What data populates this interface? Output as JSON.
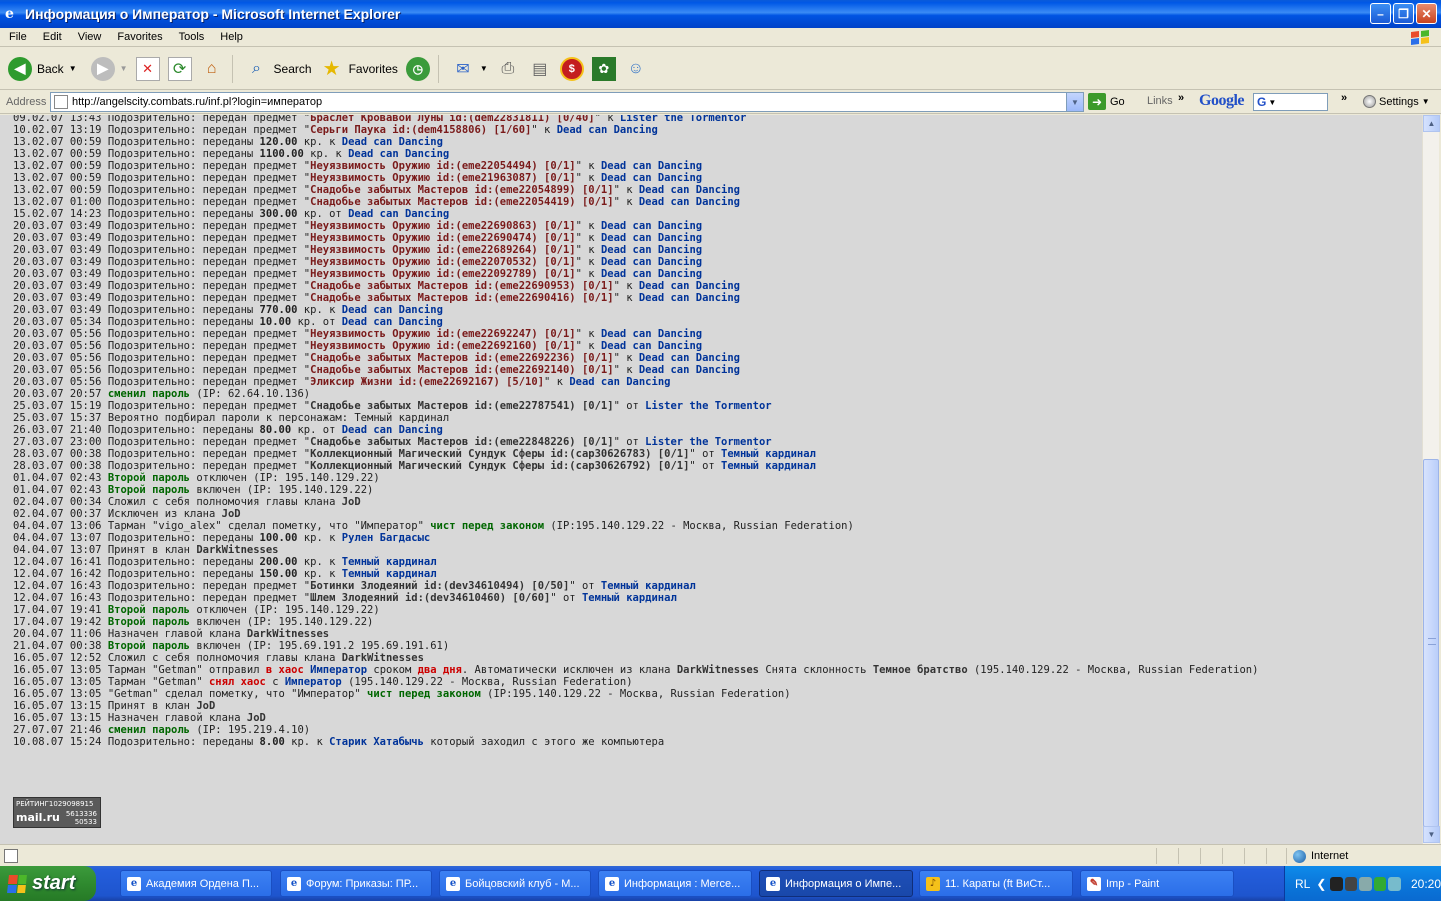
{
  "window": {
    "title": "Информация о Император - Microsoft Internet Explorer"
  },
  "menu": [
    "File",
    "Edit",
    "View",
    "Favorites",
    "Tools",
    "Help"
  ],
  "toolbar": {
    "back": "Back",
    "search": "Search",
    "favorites": "Favorites"
  },
  "address": {
    "label": "Address",
    "url": "http://angelscity.combats.ru/inf.pl?login=император",
    "go": "Go",
    "links": "Links",
    "google": "Google",
    "google_box": "G",
    "settings": "Settings"
  },
  "log": [
    [
      [
        "09.02.07 13:43 Подозрительно: передан предмет \"",
        ""
      ],
      [
        "Браслет Кровавой Луны id:(dem22831811) [0/40]",
        "item"
      ],
      [
        "\" к ",
        ""
      ],
      [
        "Lister the Tormentor",
        "user"
      ]
    ],
    [
      [
        "10.02.07 13:19 Подозрительно: передан предмет \"",
        ""
      ],
      [
        "Серьги Паука id:(dem4158806) [1/60]",
        "item"
      ],
      [
        "\" к ",
        ""
      ],
      [
        "Dead can Dancing",
        "user"
      ]
    ],
    [
      [
        "13.02.07 00:59 Подозрительно: переданы ",
        ""
      ],
      [
        "120.00",
        "b"
      ],
      [
        " кр. к ",
        ""
      ],
      [
        "Dead can Dancing",
        "user"
      ]
    ],
    [
      [
        "13.02.07 00:59 Подозрительно: переданы ",
        ""
      ],
      [
        "1100.00",
        "b"
      ],
      [
        " кр. к ",
        ""
      ],
      [
        "Dead can Dancing",
        "user"
      ]
    ],
    [
      [
        "13.02.07 00:59 Подозрительно: передан предмет \"",
        ""
      ],
      [
        "Неуязвимость Оружию id:(eme22054494) [0/1]",
        "item"
      ],
      [
        "\" к ",
        ""
      ],
      [
        "Dead can Dancing",
        "user"
      ]
    ],
    [
      [
        "13.02.07 00:59 Подозрительно: передан предмет \"",
        ""
      ],
      [
        "Неуязвимость Оружию id:(eme21963087) [0/1]",
        "item"
      ],
      [
        "\" к ",
        ""
      ],
      [
        "Dead can Dancing",
        "user"
      ]
    ],
    [
      [
        "13.02.07 00:59 Подозрительно: передан предмет \"",
        ""
      ],
      [
        "Снадобье забытых Мастеров id:(eme22054899) [0/1]",
        "item"
      ],
      [
        "\" к ",
        ""
      ],
      [
        "Dead can Dancing",
        "user"
      ]
    ],
    [
      [
        "13.02.07 01:00 Подозрительно: передан предмет \"",
        ""
      ],
      [
        "Снадобье забытых Мастеров id:(eme22054419) [0/1]",
        "item"
      ],
      [
        "\" к ",
        ""
      ],
      [
        "Dead can Dancing",
        "user"
      ]
    ],
    [
      [
        "15.02.07 14:23 Подозрительно: переданы ",
        ""
      ],
      [
        "300.00",
        "b"
      ],
      [
        " кр. от ",
        ""
      ],
      [
        "Dead can Dancing",
        "user"
      ]
    ],
    [
      [
        "20.03.07 03:49 Подозрительно: передан предмет \"",
        ""
      ],
      [
        "Неуязвимость Оружию id:(eme22690863) [0/1]",
        "item"
      ],
      [
        "\" к ",
        ""
      ],
      [
        "Dead can Dancing",
        "user"
      ]
    ],
    [
      [
        "20.03.07 03:49 Подозрительно: передан предмет \"",
        ""
      ],
      [
        "Неуязвимость Оружию id:(eme22690474) [0/1]",
        "item"
      ],
      [
        "\" к ",
        ""
      ],
      [
        "Dead can Dancing",
        "user"
      ]
    ],
    [
      [
        "20.03.07 03:49 Подозрительно: передан предмет \"",
        ""
      ],
      [
        "Неуязвимость Оружию id:(eme22689264) [0/1]",
        "item"
      ],
      [
        "\" к ",
        ""
      ],
      [
        "Dead can Dancing",
        "user"
      ]
    ],
    [
      [
        "20.03.07 03:49 Подозрительно: передан предмет \"",
        ""
      ],
      [
        "Неуязвимость Оружию id:(eme22070532) [0/1]",
        "item"
      ],
      [
        "\" к ",
        ""
      ],
      [
        "Dead can Dancing",
        "user"
      ]
    ],
    [
      [
        "20.03.07 03:49 Подозрительно: передан предмет \"",
        ""
      ],
      [
        "Неуязвимость Оружию id:(eme22092789) [0/1]",
        "item"
      ],
      [
        "\" к ",
        ""
      ],
      [
        "Dead can Dancing",
        "user"
      ]
    ],
    [
      [
        "20.03.07 03:49 Подозрительно: передан предмет \"",
        ""
      ],
      [
        "Снадобье забытых Мастеров id:(eme22690953) [0/1]",
        "item"
      ],
      [
        "\" к ",
        ""
      ],
      [
        "Dead can Dancing",
        "user"
      ]
    ],
    [
      [
        "20.03.07 03:49 Подозрительно: передан предмет \"",
        ""
      ],
      [
        "Снадобье забытых Мастеров id:(eme22690416) [0/1]",
        "item"
      ],
      [
        "\" к ",
        ""
      ],
      [
        "Dead can Dancing",
        "user"
      ]
    ],
    [
      [
        "20.03.07 03:49 Подозрительно: переданы ",
        ""
      ],
      [
        "770.00",
        "b"
      ],
      [
        " кр. к ",
        ""
      ],
      [
        "Dead can Dancing",
        "user"
      ]
    ],
    [
      [
        "20.03.07 05:34 Подозрительно: переданы ",
        ""
      ],
      [
        "10.00",
        "b"
      ],
      [
        " кр. от ",
        ""
      ],
      [
        "Dead can Dancing",
        "user"
      ]
    ],
    [
      [
        "20.03.07 05:56 Подозрительно: передан предмет \"",
        ""
      ],
      [
        "Неуязвимость Оружию id:(eme22692247) [0/1]",
        "item"
      ],
      [
        "\" к ",
        ""
      ],
      [
        "Dead can Dancing",
        "user"
      ]
    ],
    [
      [
        "20.03.07 05:56 Подозрительно: передан предмет \"",
        ""
      ],
      [
        "Неуязвимость Оружию id:(eme22692160) [0/1]",
        "item"
      ],
      [
        "\" к ",
        ""
      ],
      [
        "Dead can Dancing",
        "user"
      ]
    ],
    [
      [
        "20.03.07 05:56 Подозрительно: передан предмет \"",
        ""
      ],
      [
        "Снадобье забытых Мастеров id:(eme22692236) [0/1]",
        "item"
      ],
      [
        "\" к ",
        ""
      ],
      [
        "Dead can Dancing",
        "user"
      ]
    ],
    [
      [
        "20.03.07 05:56 Подозрительно: передан предмет \"",
        ""
      ],
      [
        "Снадобье забытых Мастеров id:(eme22692140) [0/1]",
        "item"
      ],
      [
        "\" к ",
        ""
      ],
      [
        "Dead can Dancing",
        "user"
      ]
    ],
    [
      [
        "20.03.07 05:56 Подозрительно: передан предмет \"",
        ""
      ],
      [
        "Эликсир Жизни id:(eme22692167) [5/10]",
        "item"
      ],
      [
        "\" к ",
        ""
      ],
      [
        "Dead can Dancing",
        "user"
      ]
    ],
    [
      [
        "20.03.07 20:57 ",
        ""
      ],
      [
        "сменил пароль",
        "grn"
      ],
      [
        " (IP: 62.64.10.136)",
        ""
      ]
    ],
    [
      [
        "25.03.07 15:19 Подозрительно: передан предмет \"",
        ""
      ],
      [
        "Снадобье забытых Мастеров id:(eme22787541) [0/1]",
        "dark"
      ],
      [
        "\" от ",
        ""
      ],
      [
        "Lister the Tormentor",
        "user"
      ]
    ],
    [
      [
        "25.03.07 15:37 Вероятно подбирал пароли к персонажам: Темный кардинал",
        ""
      ]
    ],
    [
      [
        "26.03.07 21:40 Подозрительно: переданы ",
        ""
      ],
      [
        "80.00",
        "b"
      ],
      [
        " кр. от ",
        ""
      ],
      [
        "Dead can Dancing",
        "user"
      ]
    ],
    [
      [
        "27.03.07 23:00 Подозрительно: передан предмет \"",
        ""
      ],
      [
        "Снадобье забытых Мастеров id:(eme22848226) [0/1]",
        "dark"
      ],
      [
        "\" от ",
        ""
      ],
      [
        "Lister the Tormentor",
        "user"
      ]
    ],
    [
      [
        "28.03.07 00:38 Подозрительно: передан предмет \"",
        ""
      ],
      [
        "Коллекционный Магический Сундук Сферы id:(cap30626783) [0/1]",
        "dark"
      ],
      [
        "\" от ",
        ""
      ],
      [
        "Темный кардинал",
        "user"
      ]
    ],
    [
      [
        "28.03.07 00:38 Подозрительно: передан предмет \"",
        ""
      ],
      [
        "Коллекционный Магический Сундук Сферы id:(cap30626792) [0/1]",
        "dark"
      ],
      [
        "\" от ",
        ""
      ],
      [
        "Темный кардинал",
        "user"
      ]
    ],
    [
      [
        "01.04.07 02:43 ",
        ""
      ],
      [
        "Второй пароль",
        "grn"
      ],
      [
        " отключен (IP: 195.140.129.22)",
        ""
      ]
    ],
    [
      [
        "01.04.07 02:43 ",
        ""
      ],
      [
        "Второй пароль",
        "grn"
      ],
      [
        " включен (IP: 195.140.129.22)",
        ""
      ]
    ],
    [
      [
        "02.04.07 00:34 Сложил с себя полномочия главы клана ",
        ""
      ],
      [
        "JoD",
        "dark"
      ]
    ],
    [
      [
        "02.04.07 00:37 Исключен из клана ",
        ""
      ],
      [
        "JoD",
        "dark"
      ]
    ],
    [
      [
        "04.04.07 13:06 Тарман \"vigo_alex\" сделал пометку, что \"Император\" ",
        ""
      ],
      [
        "чист перед законом",
        "grn"
      ],
      [
        " (IP:195.140.129.22 - Москва, Russian Federation)",
        ""
      ]
    ],
    [
      [
        "04.04.07 13:07 Подозрительно: переданы ",
        ""
      ],
      [
        "100.00",
        "b"
      ],
      [
        " кр. к ",
        ""
      ],
      [
        "Рулен Багдасыс",
        "user"
      ]
    ],
    [
      [
        "04.04.07 13:07 Принят в клан ",
        ""
      ],
      [
        "DarkWitnesses",
        "dark"
      ]
    ],
    [
      [
        "12.04.07 16:41 Подозрительно: переданы ",
        ""
      ],
      [
        "200.00",
        "b"
      ],
      [
        " кр. к ",
        ""
      ],
      [
        "Темный кардинал",
        "user"
      ]
    ],
    [
      [
        "12.04.07 16:42 Подозрительно: переданы ",
        ""
      ],
      [
        "150.00",
        "b"
      ],
      [
        " кр. к ",
        ""
      ],
      [
        "Темный кардинал",
        "user"
      ]
    ],
    [
      [
        "12.04.07 16:43 Подозрительно: передан предмет \"",
        ""
      ],
      [
        "Ботинки Злодеяний id:(dev34610494) [0/50]",
        "dark"
      ],
      [
        "\" от ",
        ""
      ],
      [
        "Темный кардинал",
        "user"
      ]
    ],
    [
      [
        "12.04.07 16:43 Подозрительно: передан предмет \"",
        ""
      ],
      [
        "Шлем Злодеяний id:(dev34610460) [0/60]",
        "dark"
      ],
      [
        "\" от ",
        ""
      ],
      [
        "Темный кардинал",
        "user"
      ]
    ],
    [
      [
        "17.04.07 19:41 ",
        ""
      ],
      [
        "Второй пароль",
        "grn"
      ],
      [
        " отключен (IP: 195.140.129.22)",
        ""
      ]
    ],
    [
      [
        "17.04.07 19:42 ",
        ""
      ],
      [
        "Второй пароль",
        "grn"
      ],
      [
        " включен (IP: 195.140.129.22)",
        ""
      ]
    ],
    [
      [
        "20.04.07 11:06 Назначен главой клана ",
        ""
      ],
      [
        "DarkWitnesses",
        "dark"
      ]
    ],
    [
      [
        "21.04.07 00:38 ",
        ""
      ],
      [
        "Второй пароль",
        "grn"
      ],
      [
        " включен (IP: 195.69.191.2 195.69.191.61)",
        ""
      ]
    ],
    [
      [
        "16.05.07 12:52 Сложил с себя полномочия главы клана ",
        ""
      ],
      [
        "DarkWitnesses",
        "dark"
      ]
    ],
    [
      [
        "16.05.07 13:05 Тарман \"Getman\" отправил ",
        ""
      ],
      [
        "в хаос",
        "red"
      ],
      [
        " ",
        ""
      ],
      [
        "Император",
        "user"
      ],
      [
        " сроком ",
        ""
      ],
      [
        "два дня",
        "red"
      ],
      [
        ". Автоматически исключен из клана ",
        ""
      ],
      [
        "DarkWitnesses",
        "dark"
      ],
      [
        " Снята склонность ",
        ""
      ],
      [
        "Темное братство",
        "dark"
      ],
      [
        " (195.140.129.22 - Москва, Russian Federation)",
        ""
      ]
    ],
    [
      [
        "16.05.07 13:05 Тарман \"Getman\" ",
        ""
      ],
      [
        "снял хаос",
        "red"
      ],
      [
        " с ",
        ""
      ],
      [
        "Император",
        "user"
      ],
      [
        " (195.140.129.22 - Москва, Russian Federation)",
        ""
      ]
    ],
    [
      [
        "16.05.07 13:05 \"Getman\" сделал пометку, что \"Император\" ",
        ""
      ],
      [
        "чист перед законом",
        "grn"
      ],
      [
        " (IP:195.140.129.22 - Москва, Russian Federation)",
        ""
      ]
    ],
    [
      [
        "16.05.07 13:15 Принят в клан ",
        ""
      ],
      [
        "JoD",
        "dark"
      ]
    ],
    [
      [
        "16.05.07 13:15 Назначен главой клана ",
        ""
      ],
      [
        "JoD",
        "dark"
      ]
    ],
    [
      [
        "27.07.07 21:46 ",
        ""
      ],
      [
        "сменил пароль",
        "grn"
      ],
      [
        " (IP: 195.219.4.10)",
        ""
      ]
    ],
    [
      [
        "10.08.07 15:24 Подозрительно: переданы ",
        ""
      ],
      [
        "8.00",
        "b"
      ],
      [
        " кр. к ",
        ""
      ],
      [
        "Старик Хатабычь",
        "user"
      ],
      [
        " который заходил с этого же компьютера",
        ""
      ]
    ]
  ],
  "counter": {
    "top": "РЕЙТИНГ1029098915",
    "brand": "mail.ru",
    "n1": "5613336",
    "n2": "50533"
  },
  "status": {
    "zone": "Internet"
  },
  "taskbar": {
    "start": "start",
    "tasks": [
      "Академия Ордена П...",
      "Форум: Приказы: ПР...",
      "Бойцовский клуб - М...",
      "Информация : Merce...",
      "Информация о Импе...",
      "11. Караты (ft ВиСт...",
      "Imp - Paint"
    ],
    "lang": "RL",
    "clock": "20:20"
  }
}
